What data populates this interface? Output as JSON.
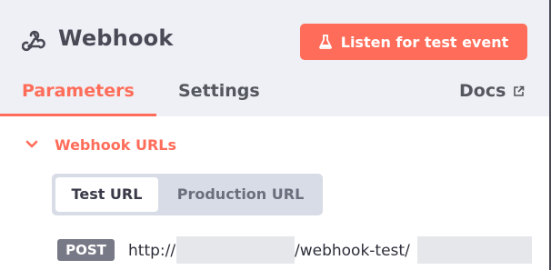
{
  "header": {
    "title": "Webhook",
    "listen_button_label": "Listen for test event"
  },
  "tabs": [
    {
      "label": "Parameters",
      "active": true
    },
    {
      "label": "Settings",
      "active": false
    },
    {
      "label": "Docs",
      "active": false
    }
  ],
  "section": {
    "title": "Webhook URLs",
    "expanded": true
  },
  "url_toggle": {
    "options": [
      "Test URL",
      "Production URL"
    ],
    "selected": "Test URL"
  },
  "url_row": {
    "method": "POST",
    "prefix": "http://",
    "middle": "/webhook-test/"
  },
  "icons": {
    "node_icon": "webhook-icon",
    "button_icon": "flask-icon",
    "docs_icon": "external-link-icon",
    "section_icon": "chevron-down-icon"
  },
  "colors": {
    "accent": "#ff6d5a",
    "header_bg": "#eff0f5",
    "toggle_bg": "#d8dce6",
    "badge_bg": "#777986"
  }
}
